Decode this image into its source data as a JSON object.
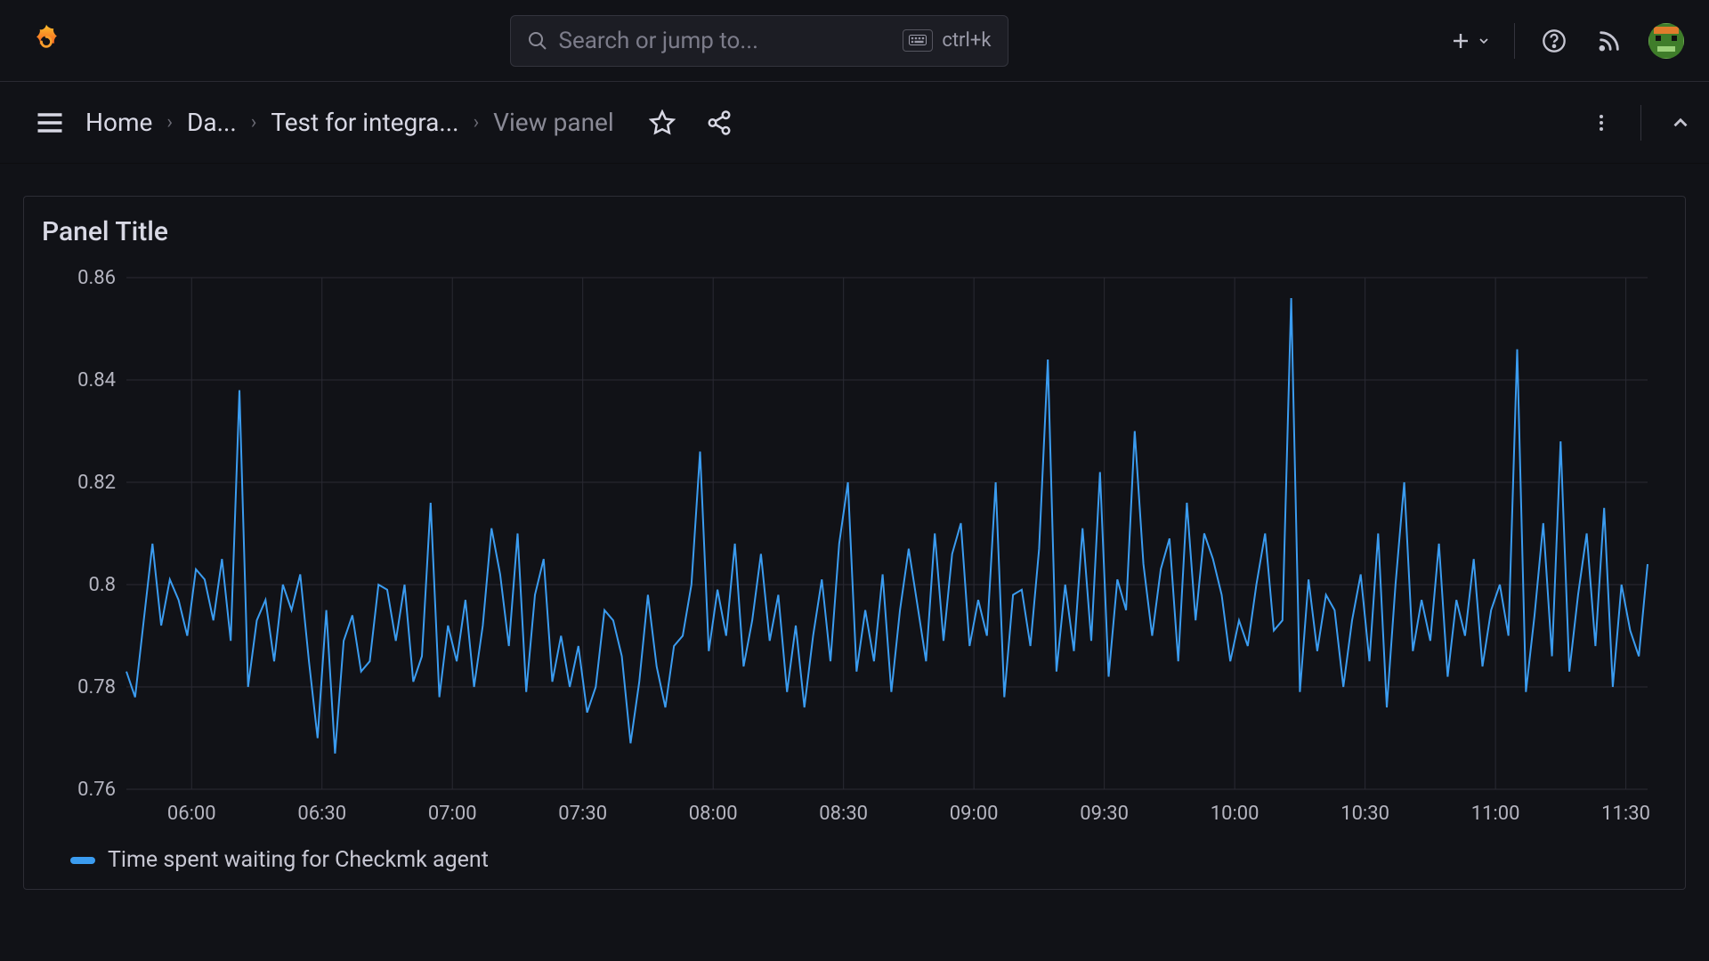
{
  "header": {
    "search_placeholder": "Search or jump to...",
    "shortcut": "ctrl+k"
  },
  "breadcrumbs": {
    "home": "Home",
    "dashboards": "Da...",
    "item": "Test for integra...",
    "view": "View panel"
  },
  "panel": {
    "title": "Panel Title"
  },
  "legend": {
    "series1": "Time spent waiting for Checkmk agent"
  },
  "chart_data": {
    "type": "line",
    "title": "Panel Title",
    "xlabel": "",
    "ylabel": "",
    "ylim": [
      0.76,
      0.86
    ],
    "y_ticks": [
      0.76,
      0.78,
      0.8,
      0.82,
      0.84,
      0.86
    ],
    "x_ticks": [
      "06:00",
      "06:30",
      "07:00",
      "07:30",
      "08:00",
      "08:30",
      "09:00",
      "09:30",
      "10:00",
      "10:30",
      "11:00",
      "11:30"
    ],
    "x_range_minutes": [
      345,
      695
    ],
    "series": [
      {
        "name": "Time spent waiting for Checkmk agent",
        "color": "#3b9cf0",
        "values": [
          0.783,
          0.778,
          0.793,
          0.808,
          0.792,
          0.801,
          0.797,
          0.79,
          0.803,
          0.801,
          0.793,
          0.805,
          0.789,
          0.838,
          0.78,
          0.793,
          0.797,
          0.785,
          0.8,
          0.795,
          0.802,
          0.785,
          0.77,
          0.795,
          0.767,
          0.789,
          0.794,
          0.783,
          0.785,
          0.8,
          0.799,
          0.789,
          0.8,
          0.781,
          0.786,
          0.816,
          0.778,
          0.792,
          0.785,
          0.797,
          0.78,
          0.792,
          0.811,
          0.802,
          0.788,
          0.81,
          0.779,
          0.798,
          0.805,
          0.781,
          0.79,
          0.78,
          0.788,
          0.775,
          0.78,
          0.795,
          0.793,
          0.786,
          0.769,
          0.781,
          0.798,
          0.784,
          0.776,
          0.788,
          0.79,
          0.8,
          0.826,
          0.787,
          0.799,
          0.79,
          0.808,
          0.784,
          0.793,
          0.806,
          0.789,
          0.798,
          0.779,
          0.792,
          0.776,
          0.79,
          0.801,
          0.785,
          0.808,
          0.82,
          0.783,
          0.795,
          0.785,
          0.802,
          0.779,
          0.795,
          0.807,
          0.796,
          0.785,
          0.81,
          0.789,
          0.806,
          0.812,
          0.788,
          0.797,
          0.79,
          0.82,
          0.778,
          0.798,
          0.799,
          0.788,
          0.807,
          0.844,
          0.783,
          0.8,
          0.787,
          0.811,
          0.789,
          0.822,
          0.782,
          0.801,
          0.795,
          0.83,
          0.804,
          0.79,
          0.803,
          0.809,
          0.785,
          0.816,
          0.793,
          0.81,
          0.805,
          0.798,
          0.785,
          0.793,
          0.788,
          0.8,
          0.81,
          0.791,
          0.793,
          0.856,
          0.779,
          0.801,
          0.787,
          0.798,
          0.795,
          0.78,
          0.793,
          0.802,
          0.785,
          0.81,
          0.776,
          0.8,
          0.82,
          0.787,
          0.797,
          0.789,
          0.808,
          0.782,
          0.797,
          0.79,
          0.805,
          0.784,
          0.795,
          0.8,
          0.79,
          0.846,
          0.779,
          0.794,
          0.812,
          0.786,
          0.828,
          0.783,
          0.798,
          0.81,
          0.788,
          0.815,
          0.78,
          0.8,
          0.791,
          0.786,
          0.804
        ]
      }
    ]
  }
}
